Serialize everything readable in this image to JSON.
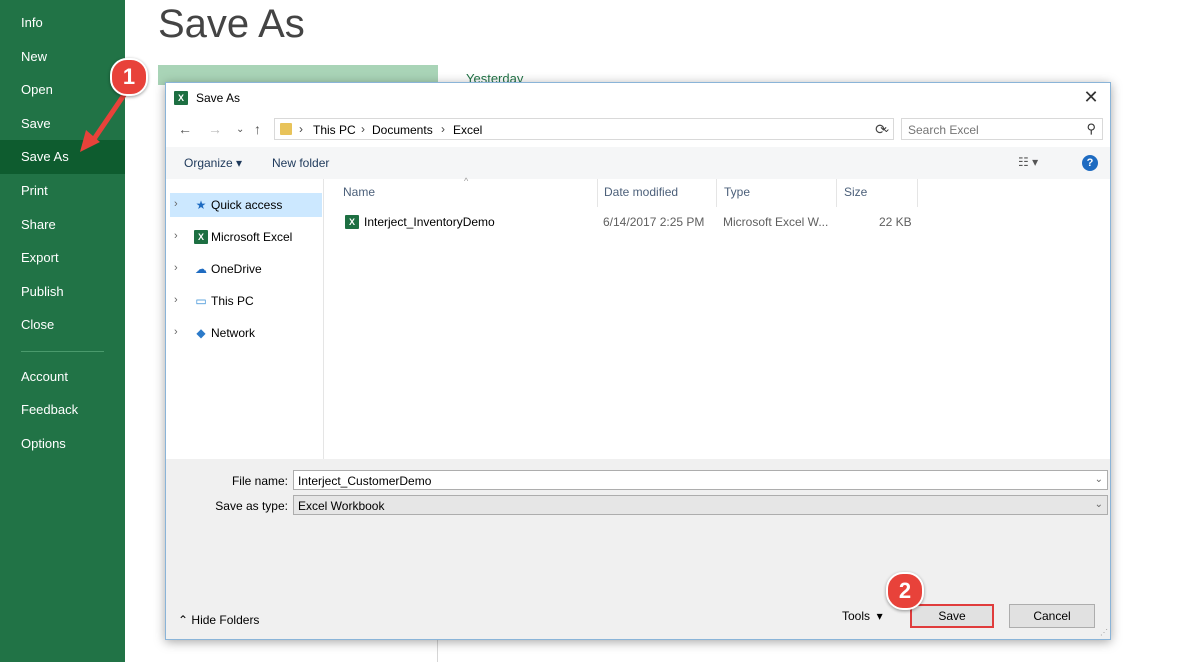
{
  "backstage": {
    "nav": [
      {
        "label": "Info"
      },
      {
        "label": "New"
      },
      {
        "label": "Open"
      },
      {
        "label": "Save"
      },
      {
        "label": "Save As",
        "active": true
      },
      {
        "label": "Print"
      },
      {
        "label": "Share"
      },
      {
        "label": "Export"
      },
      {
        "label": "Publish"
      },
      {
        "label": "Close"
      },
      {
        "label": "Account"
      },
      {
        "label": "Feedback"
      },
      {
        "label": "Options"
      }
    ],
    "page_title": "Save As",
    "recent_group": "Yesterday",
    "accent": "#217346"
  },
  "dialog": {
    "title": "Save As",
    "icon": "excel-icon",
    "address": [
      "This PC",
      "Documents",
      "Excel"
    ],
    "search_placeholder": "Search Excel",
    "toolbar": {
      "organize": "Organize",
      "new_folder": "New folder"
    },
    "tree": [
      {
        "label": "Quick access",
        "icon": "star-icon",
        "selected": true
      },
      {
        "label": "Microsoft Excel",
        "icon": "excel-icon"
      },
      {
        "label": "OneDrive",
        "icon": "cloud-icon"
      },
      {
        "label": "This PC",
        "icon": "computer-icon"
      },
      {
        "label": "Network",
        "icon": "network-icon"
      }
    ],
    "columns": {
      "name": "Name",
      "date": "Date modified",
      "type": "Type",
      "size": "Size"
    },
    "files": [
      {
        "name": "Interject_InventoryDemo",
        "date": "6/14/2017 2:25 PM",
        "type": "Microsoft Excel W...",
        "size": "22 KB"
      }
    ],
    "file_name_label": "File name:",
    "file_name_value": "Interject_CustomerDemo",
    "save_type_label": "Save as type:",
    "save_type_value": "Excel Workbook",
    "hide_folders": "Hide Folders",
    "tools": "Tools",
    "save": "Save",
    "cancel": "Cancel"
  },
  "callouts": {
    "step1": "1",
    "step2": "2",
    "color": "#e8423a"
  }
}
